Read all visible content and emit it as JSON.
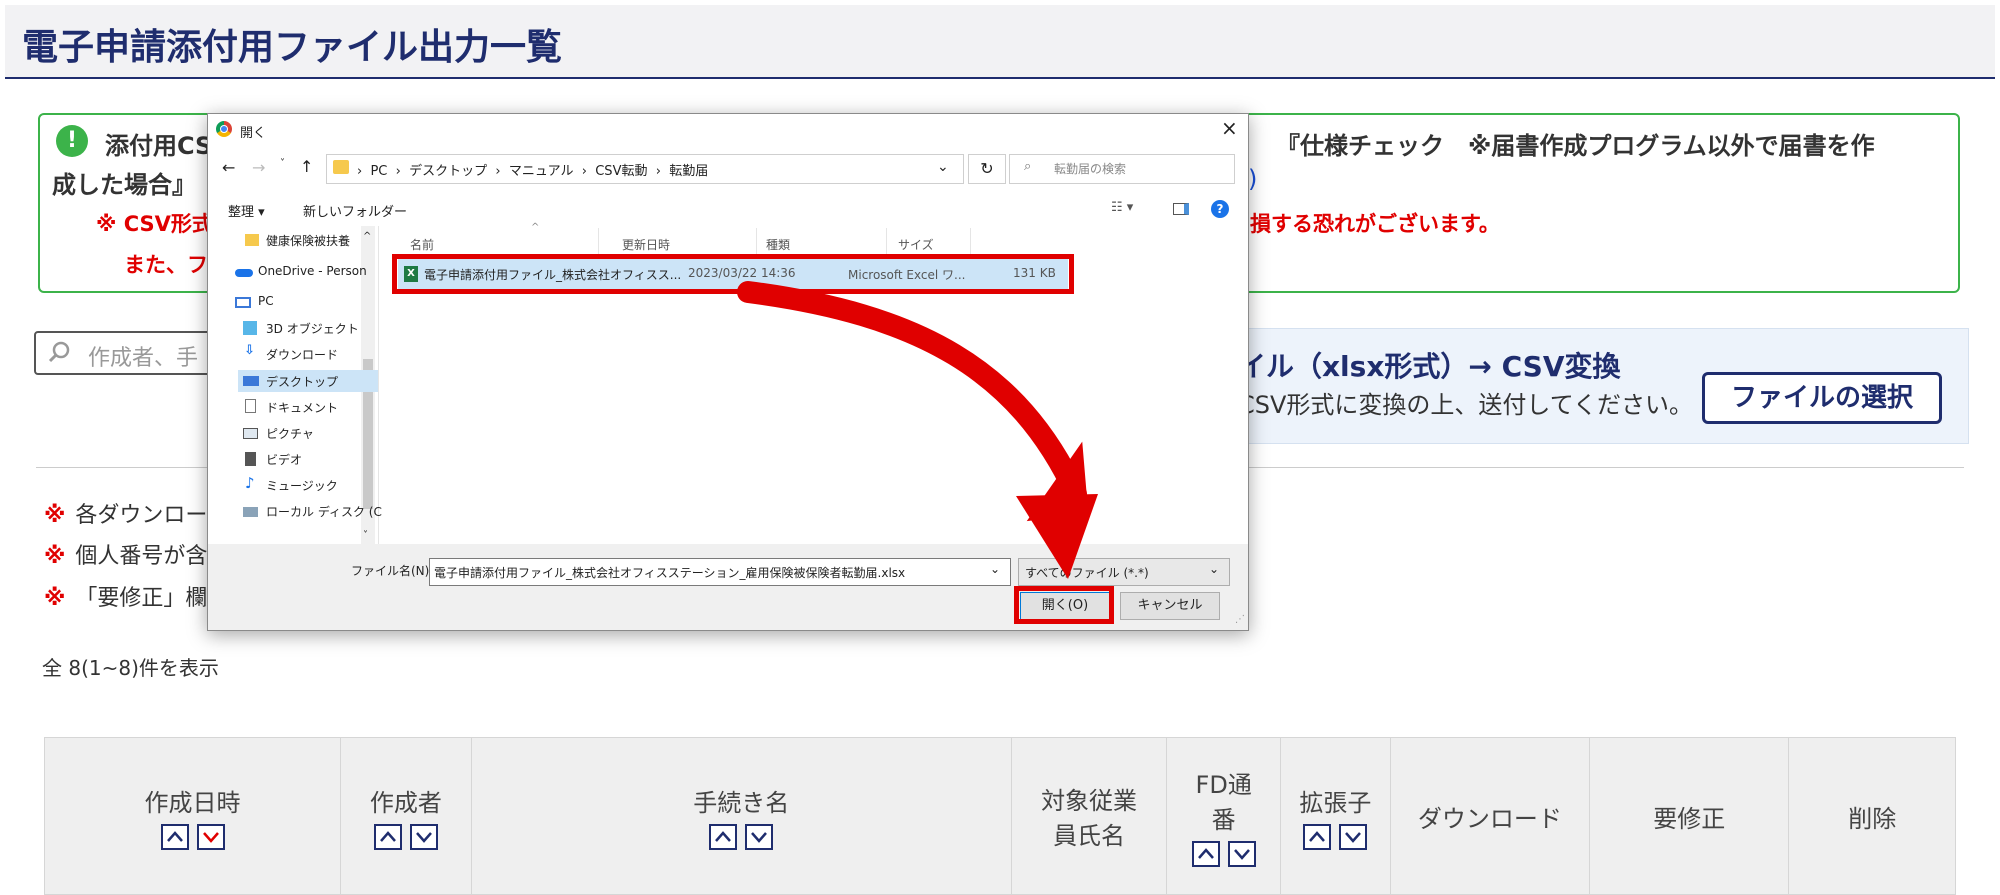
{
  "page": {
    "title": "電子申請添付用ファイル出力一覧"
  },
  "notice": {
    "line1_left": "添付用CS",
    "line1_right": "『仕様チェック　※届書作成プログラム以外で届書を作",
    "line2_left": "成した場合』",
    "line2_link": ")",
    "red_line1_left": "※ CSV形式",
    "red_line1_right": "損する恐れがございます。",
    "red_line2_left": "また、フ"
  },
  "search": {
    "placeholder": "作成者、手"
  },
  "csv_panel": {
    "title": "イル（xlsx形式）→ CSV変換",
    "desc": "CSV形式に変換の上、送付してください。",
    "button": "ファイルの選択"
  },
  "notes": [
    {
      "mark": "※",
      "text": "各ダウンロー"
    },
    {
      "mark": "※",
      "text": "個人番号が含"
    },
    {
      "mark": "※",
      "text": "「要修正」欄"
    }
  ],
  "count_text": "全 8(1~8)件を表示",
  "table": {
    "headers": [
      "作成日時",
      "作成者",
      "手続き名",
      "対象従業員氏名",
      "FD通番",
      "拡張子",
      "ダウンロード",
      "要修正",
      "削除"
    ],
    "header_lines": {
      "employee_1": "対象従業",
      "employee_2": "員氏名",
      "fd_1": "FD通",
      "fd_2": "番"
    }
  },
  "dialog": {
    "title": "開く",
    "breadcrumb": [
      "PC",
      "デスクトップ",
      "マニュアル",
      "CSV転動",
      "転勤届"
    ],
    "search_placeholder": "転勤届の検索",
    "organize": "整理 ▾",
    "new_folder": "新しいフォルダー",
    "nav_items": [
      "健康保険被扶養",
      "OneDrive - Person",
      "PC",
      "3D オブジェクト",
      "ダウンロード",
      "デスクトップ",
      "ドキュメント",
      "ピクチャ",
      "ビデオ",
      "ミュージック",
      "ローカル ディスク (C"
    ],
    "columns": [
      "名前",
      "更新日時",
      "種類",
      "サイズ"
    ],
    "file": {
      "name": "電子申請添付用ファイル_株式会社オフィスス...",
      "date": "2023/03/22 14:36",
      "type": "Microsoft Excel ワ...",
      "size": "131 KB"
    },
    "filename_label": "ファイル名(N):",
    "filename_value": "電子申請添付用ファイル_株式会社オフィスステーション_雇用保険被保険者転勤届.xlsx",
    "filetype": "すべてのファイル (*.*)",
    "open_button": "開く(O)",
    "cancel_button": "キャンセル"
  },
  "colors": {
    "brand": "#1f2d6e",
    "accent_red": "#e00000",
    "notice_green": "#3cb34a"
  }
}
